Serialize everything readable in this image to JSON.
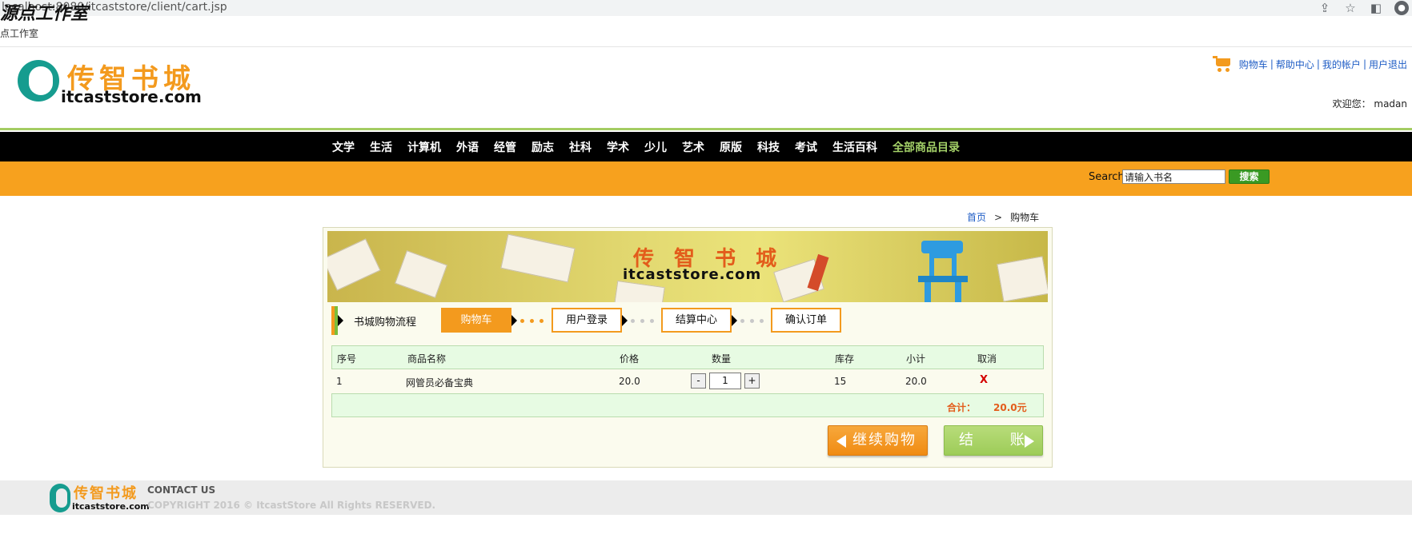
{
  "browser": {
    "url": "localhost:8080/itcaststore/client/cart.jsp",
    "watermark": "源点工作室",
    "page_title_text": "点工作室",
    "icons": [
      "share-icon",
      "star-icon",
      "sidebar-icon",
      "profile-icon"
    ]
  },
  "header": {
    "logo_cn": "传智书城",
    "logo_en": "itcaststore.com",
    "links": {
      "cart": "购物车",
      "help": "帮助中心",
      "account": "我的帐户",
      "logout": "用户退出",
      "separator": "|"
    },
    "welcome": "欢迎您： madan"
  },
  "nav": {
    "items": [
      "文学",
      "生活",
      "计算机",
      "外语",
      "经管",
      "励志",
      "社科",
      "学术",
      "少儿",
      "艺术",
      "原版",
      "科技",
      "考试",
      "生活百科"
    ],
    "all_label": "全部商品目录"
  },
  "search": {
    "label": "Search",
    "value": "请输入书名",
    "button": "搜索"
  },
  "breadcrumb": {
    "home": "首页",
    "separator": ">",
    "current": "购物车"
  },
  "banner": {
    "cn": "传 智 书 城",
    "en": "itcaststore.com"
  },
  "flow": {
    "label": "书城购物流程",
    "steps": [
      "购物车",
      "用户登录",
      "结算中心",
      "确认订单"
    ]
  },
  "cart": {
    "headers": {
      "index": "序号",
      "name": "商品名称",
      "price": "价格",
      "quantity": "数量",
      "stock": "库存",
      "subtotal": "小计",
      "cancel": "取消"
    },
    "rows": [
      {
        "index": "1",
        "name": "网管员必备宝典",
        "price": "20.0",
        "minus": "-",
        "quantity": "1",
        "plus": "+",
        "stock": "15",
        "subtotal": "20.0",
        "cancel": "X"
      }
    ],
    "total_label": "合计：",
    "total_value": "20.0元",
    "continue_button": "继续购物",
    "checkout_button": "结 账"
  },
  "footer": {
    "logo_cn": "传智书城",
    "logo_en": "itcaststore.com",
    "contact": "CONTACT US",
    "copyright": "COPYRIGHT 2016 © ItcastStore All Rights RESERVED."
  },
  "colors": {
    "brand_orange": "#f39a1e",
    "nav_black": "#000000",
    "accent_green": "#a4cd63",
    "table_green": "#e7fbe3",
    "total_red": "#e35c1b",
    "link_blue": "#1f5dc5"
  }
}
